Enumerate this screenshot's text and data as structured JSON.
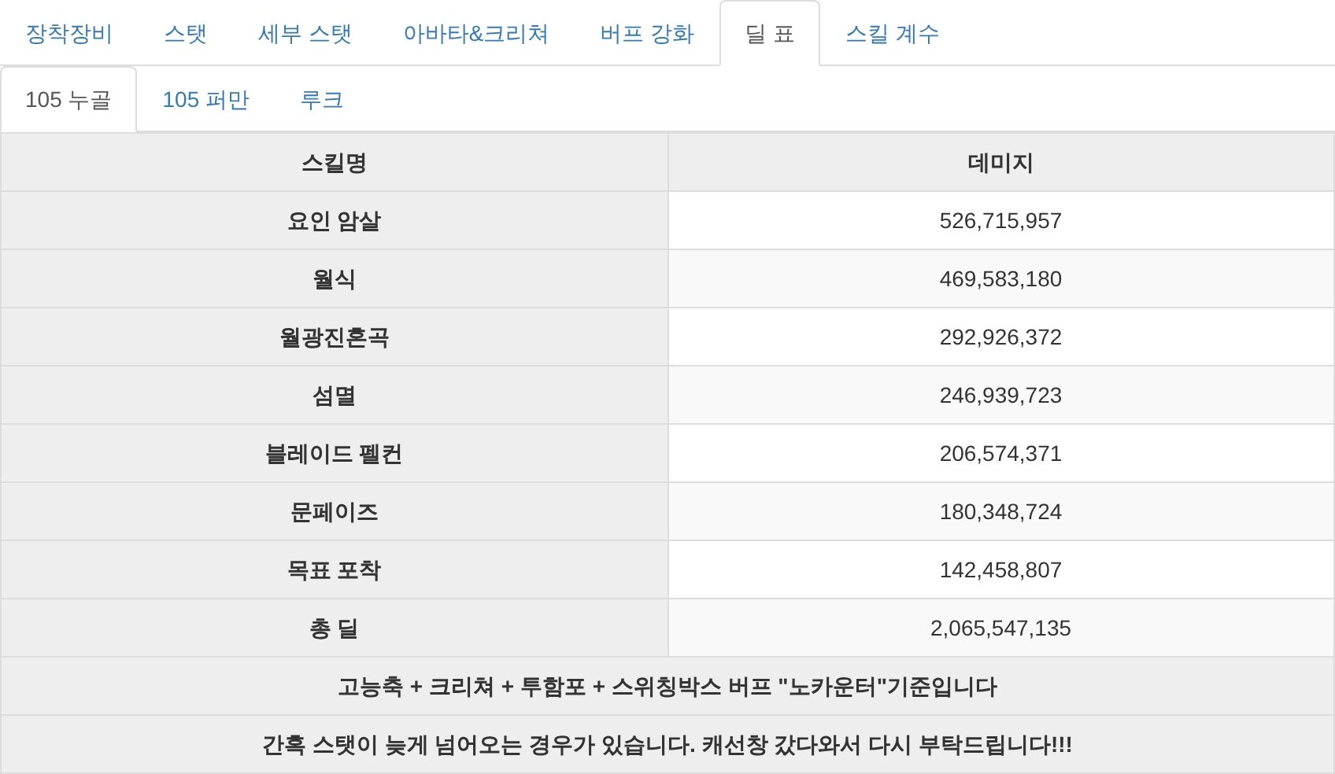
{
  "tabs": [
    {
      "label": "장착장비",
      "selected": false
    },
    {
      "label": "스탯",
      "selected": false
    },
    {
      "label": "세부 스탯",
      "selected": false
    },
    {
      "label": "아바타&크리쳐",
      "selected": false
    },
    {
      "label": "버프 강화",
      "selected": false
    },
    {
      "label": "딜 표",
      "selected": true
    },
    {
      "label": "스킬 계수",
      "selected": false
    }
  ],
  "subtabs": [
    {
      "label": "105 누골",
      "selected": true
    },
    {
      "label": "105 퍼만",
      "selected": false
    },
    {
      "label": "루크",
      "selected": false
    }
  ],
  "table": {
    "columns": [
      "스킬명",
      "데미지"
    ],
    "rows": [
      [
        "요인 암살",
        "526,715,957"
      ],
      [
        "월식",
        "469,583,180"
      ],
      [
        "월광진혼곡",
        "292,926,372"
      ],
      [
        "섬멸",
        "246,939,723"
      ],
      [
        "블레이드 펠컨",
        "206,574,371"
      ],
      [
        "문페이즈",
        "180,348,724"
      ],
      [
        "목표 포착",
        "142,458,807"
      ],
      [
        "총 딜",
        "2,065,547,135"
      ]
    ],
    "notes": [
      "고능축 + 크리쳐 + 투함포 + 스위칭박스 버프 \"노카운터\"기준입니다",
      "간혹 스탯이 늦게 넘어오는 경우가 있습니다. 캐선창 갔다와서 다시 부탁드립니다!!!"
    ]
  }
}
